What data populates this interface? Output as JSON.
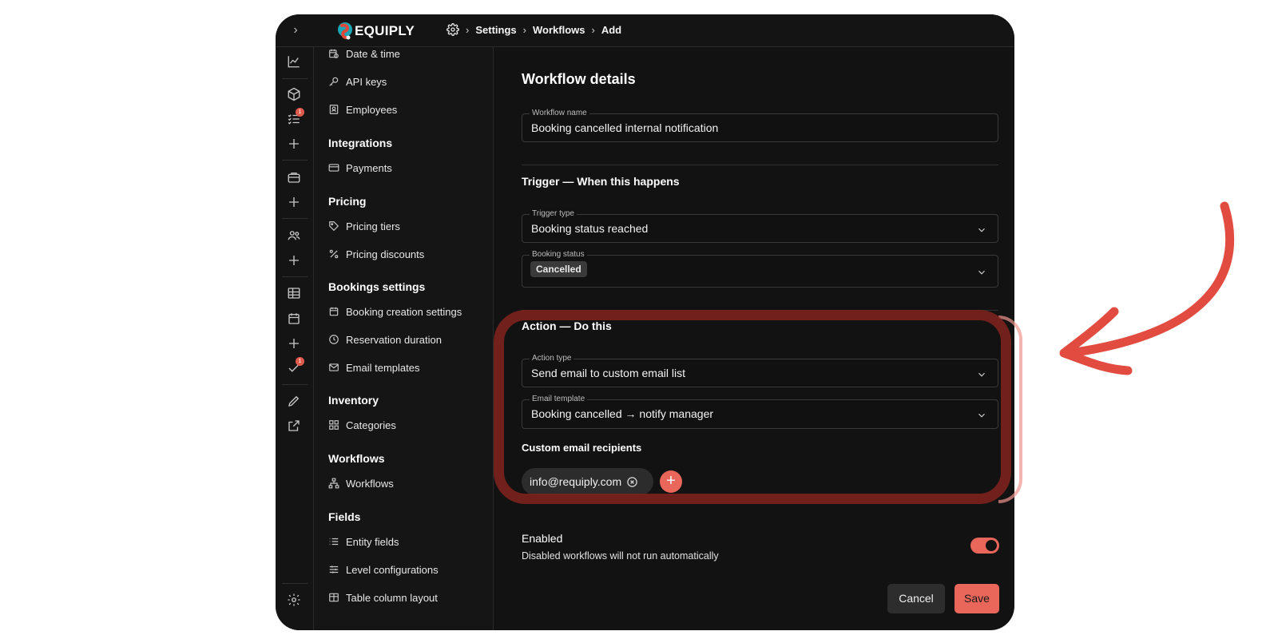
{
  "brand": {
    "name": "EQUIPLY"
  },
  "breadcrumb": {
    "items": [
      "Settings",
      "Workflows",
      "Add"
    ]
  },
  "rail": {
    "icons": [
      "chart-icon",
      "box-icon",
      "checklist-icon",
      "plus-icon",
      "briefcase-icon",
      "plus-icon",
      "users-icon",
      "plus-icon",
      "table-icon",
      "calendar-icon",
      "plus-icon",
      "check-icon",
      "pencil-icon",
      "external-link-icon",
      "settings-icon"
    ],
    "badges": {
      "checklist": "1",
      "check": "1"
    }
  },
  "nav": {
    "items": [
      {
        "label": "Date & time",
        "icon": "calendar-clock-icon"
      },
      {
        "label": "API keys",
        "icon": "key-icon"
      },
      {
        "label": "Employees",
        "icon": "contacts-icon"
      }
    ],
    "groups": {
      "integrations": {
        "title": "Integrations",
        "items": [
          {
            "label": "Payments",
            "icon": "credit-card-icon"
          }
        ]
      },
      "pricing": {
        "title": "Pricing",
        "items": [
          {
            "label": "Pricing tiers",
            "icon": "tag-icon"
          },
          {
            "label": "Pricing discounts",
            "icon": "percent-icon"
          }
        ]
      },
      "bookings": {
        "title": "Bookings settings",
        "items": [
          {
            "label": "Booking creation settings",
            "icon": "calendar-icon"
          },
          {
            "label": "Reservation duration",
            "icon": "clock-icon"
          },
          {
            "label": "Email templates",
            "icon": "mail-icon"
          }
        ]
      },
      "inventory": {
        "title": "Inventory",
        "items": [
          {
            "label": "Categories",
            "icon": "grid-icon"
          }
        ]
      },
      "workflows": {
        "title": "Workflows",
        "items": [
          {
            "label": "Workflows",
            "icon": "sitemap-icon"
          }
        ]
      },
      "fields": {
        "title": "Fields",
        "items": [
          {
            "label": "Entity fields",
            "icon": "list-icon"
          },
          {
            "label": "Level configurations",
            "icon": "sliders-icon"
          },
          {
            "label": "Table column layout",
            "icon": "table-icon"
          }
        ]
      }
    }
  },
  "form": {
    "details_title": "Workflow details",
    "workflow_name": {
      "label": "Workflow name",
      "value": "Booking cancelled internal notification"
    },
    "trigger_title": "Trigger — When this happens",
    "trigger_type": {
      "label": "Trigger type",
      "value": "Booking status reached"
    },
    "booking_status": {
      "label": "Booking status",
      "value": "Cancelled"
    },
    "action_title": "Action — Do this",
    "action_type": {
      "label": "Action type",
      "value": "Send email to custom email list"
    },
    "email_template": {
      "label": "Email template",
      "value": "Booking cancelled → notify manager"
    },
    "recipients_label": "Custom email recipients",
    "recipients": [
      "info@requiply.com"
    ],
    "enabled": {
      "label": "Enabled",
      "help": "Disabled workflows will not run automatically",
      "value": true
    },
    "cancel_label": "Cancel",
    "save_label": "Save"
  },
  "colors": {
    "accent": "#e8665a",
    "background": "#121212",
    "highlight": "#82231e"
  }
}
